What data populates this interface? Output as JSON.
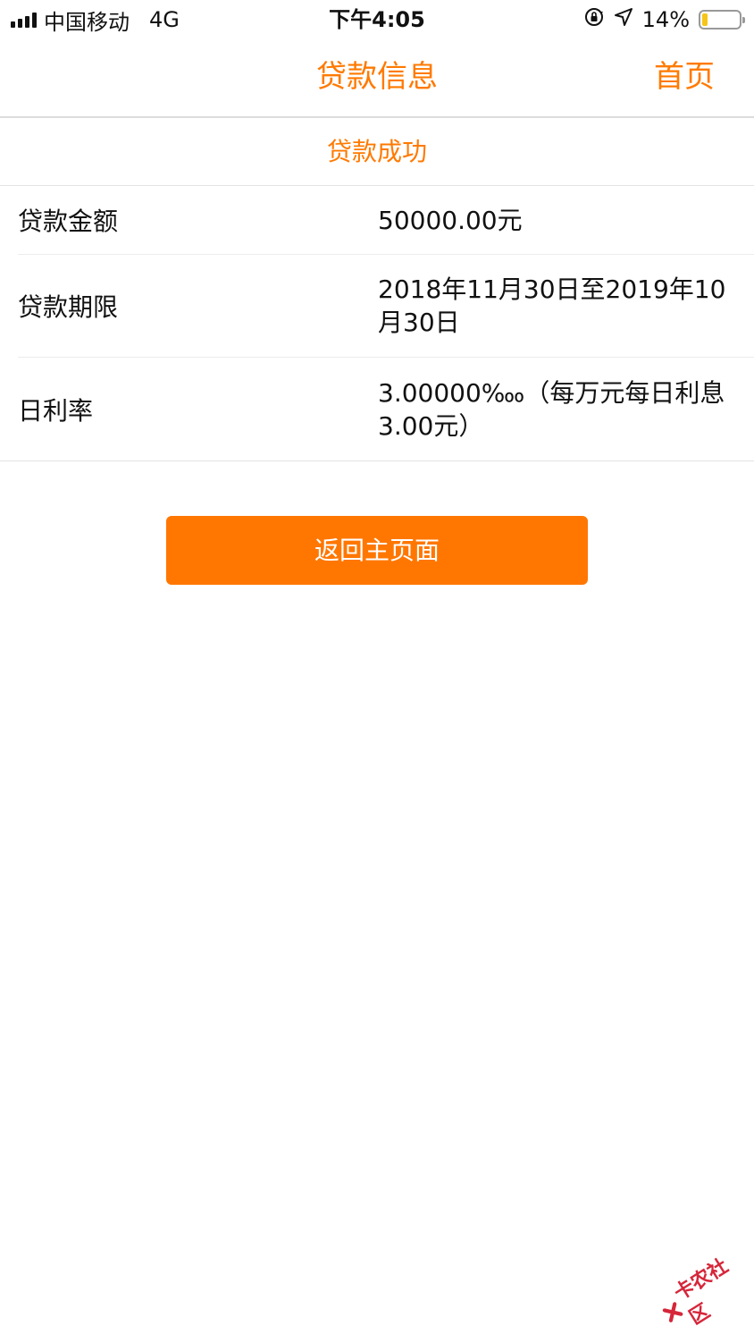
{
  "status_bar": {
    "carrier": "中国移动",
    "network": "4G",
    "time": "下午4:05",
    "battery": "14%",
    "battery_level": 0.14
  },
  "nav": {
    "title": "贷款信息",
    "home_link": "首页"
  },
  "banner": {
    "text": "贷款成功"
  },
  "info": {
    "rows": [
      {
        "label": "贷款金额",
        "value": "50000.00元"
      },
      {
        "label": "贷款期限",
        "value": "2018年11月30日至2019年10月30日"
      },
      {
        "label": "日利率",
        "value": "3.00000‱（每万元每日利息3.00元）"
      }
    ]
  },
  "actions": {
    "return_button": "返回主页面"
  },
  "watermark": {
    "text": "卡农社区"
  },
  "colors": {
    "accent": "#ff7a00",
    "button": "#ff7700",
    "battery_fill": "#f5c518"
  }
}
